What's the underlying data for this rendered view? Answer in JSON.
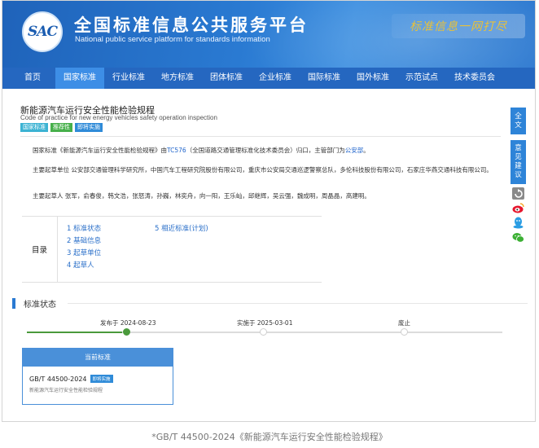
{
  "header": {
    "logo_text": "SAC",
    "title": "全国标准信息公共服务平台",
    "subtitle": "National public service platform  for standards information",
    "slogan": "标准信息一网打尽"
  },
  "nav": {
    "items": [
      "首页",
      "国家标准",
      "行业标准",
      "地方标准",
      "团体标准",
      "企业标准",
      "国际标准",
      "国外标准",
      "示范试点",
      "技术委员会"
    ],
    "active_index": 1
  },
  "standard": {
    "title_cn": "新能源汽车运行安全性能检验规程",
    "title_en": "Code of practice for new energy vehicles safety operation inspection",
    "tags": [
      "国家标准",
      "推荐性",
      "即将实施"
    ],
    "desc_p1": {
      "a": "国家标准《新能源汽车运行安全性能检验规程》由",
      "tc": "TC576",
      "b": "（全国道路交通管理标准化技术委员会）归口，主管部门为",
      "dept": "公安部",
      "c": "。"
    },
    "desc_p2": "主要起草单位 公安部交通管理科学研究所，中国汽车工程研究院股份有限公司，重庆市公安局交通巡逻警察总队，多伦科技股份有限公司，石家庄华燕交通科技有限公司。",
    "desc_p3": "主要起草人 张军，俞春俊，韩文浩，张怒涛，孙巍，林奕舟，向一阳，王乐屾，邱继辉，吴云强，魏成明，周晶晶，高建明。"
  },
  "toc": {
    "label": "目录",
    "items": [
      "1  标准状态",
      "2  基础信息",
      "3  起草单位",
      "4  起草人",
      "5  相近标准(计划)"
    ]
  },
  "status": {
    "section_title": "标准状态",
    "published": "发布于 2024-08-23",
    "effective": "实施于 2025-03-01",
    "abolished": "废止",
    "progress": 0.2
  },
  "current": {
    "head": "当前标准",
    "code": "GB/T 44500-2024",
    "badge": "即将实施",
    "name": "新能源汽车运行安全性能检验规程"
  },
  "sidebar": {
    "fulltext": [
      "全",
      "文"
    ],
    "feedback": [
      "意",
      "见",
      "建",
      "议"
    ]
  },
  "caption": "*GB/T 44500-2024《新能源汽车运行安全性能检验规程》",
  "colors": {
    "header_blue": "#2567c0",
    "nav_active": "#3d8ee6",
    "link": "#2266cc",
    "progress_green": "#4a9a3c"
  }
}
